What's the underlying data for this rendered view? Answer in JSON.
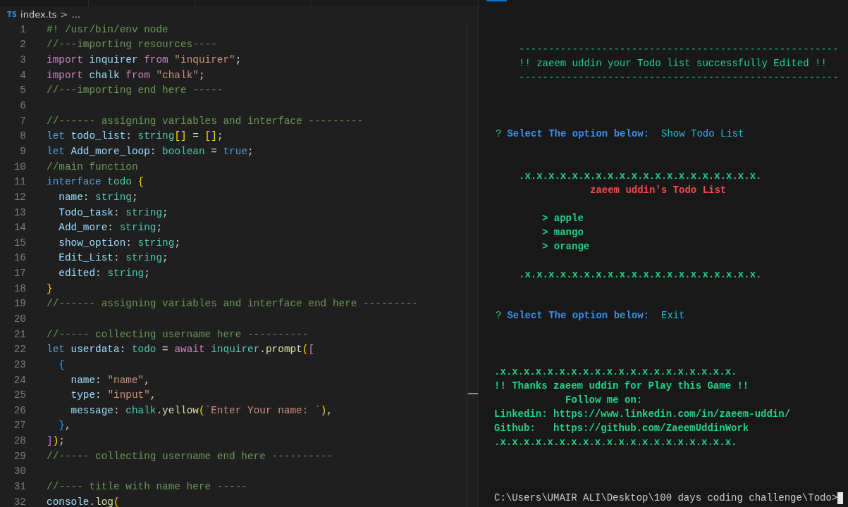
{
  "editor": {
    "breadcrumb": {
      "file_badge": "TS",
      "file": "index.ts",
      "separator": ">",
      "more": "..."
    },
    "lines": [
      {
        "number": "1",
        "tokens": [
          {
            "text": "#! /usr/bin/env node",
            "kind": "comment"
          }
        ]
      },
      {
        "number": "2",
        "tokens": [
          {
            "text": "//---importing resources----",
            "kind": "comment"
          }
        ]
      },
      {
        "number": "3",
        "tokens": [
          {
            "text": "import",
            "kind": "keyword"
          },
          {
            "text": " inquirer ",
            "kind": "variable"
          },
          {
            "text": "from",
            "kind": "keyword"
          },
          {
            "text": " \"inquirer\"",
            "kind": "string"
          },
          {
            "text": ";",
            "kind": "punct"
          }
        ]
      },
      {
        "number": "4",
        "tokens": [
          {
            "text": "import",
            "kind": "keyword"
          },
          {
            "text": " chalk ",
            "kind": "variable"
          },
          {
            "text": "from",
            "kind": "keyword"
          },
          {
            "text": " \"chalk\"",
            "kind": "string"
          },
          {
            "text": ";",
            "kind": "punct"
          }
        ]
      },
      {
        "number": "5",
        "tokens": [
          {
            "text": "//---importing end here -----",
            "kind": "comment"
          }
        ]
      },
      {
        "number": "6"
      },
      {
        "number": "7",
        "tokens": [
          {
            "text": "//------ assigning variables and interface ---------",
            "kind": "comment"
          }
        ]
      },
      {
        "number": "8",
        "tokens": [
          {
            "text": "let",
            "kind": "storage"
          },
          {
            "text": " todo_list",
            "kind": "variable"
          },
          {
            "text": ": ",
            "kind": "punct"
          },
          {
            "text": "string",
            "kind": "type"
          },
          {
            "text": "[]",
            "kind": "bracket1"
          },
          {
            "text": " = ",
            "kind": "punct"
          },
          {
            "text": "[]",
            "kind": "bracket1"
          },
          {
            "text": ";",
            "kind": "punct"
          }
        ]
      },
      {
        "number": "9",
        "tokens": [
          {
            "text": "let",
            "kind": "storage"
          },
          {
            "text": " Add_more_loop",
            "kind": "variable"
          },
          {
            "text": ": ",
            "kind": "punct"
          },
          {
            "text": "boolean",
            "kind": "type"
          },
          {
            "text": " = ",
            "kind": "punct"
          },
          {
            "text": "true",
            "kind": "storage"
          },
          {
            "text": ";",
            "kind": "punct"
          }
        ]
      },
      {
        "number": "10",
        "tokens": [
          {
            "text": "//main function",
            "kind": "comment"
          }
        ]
      },
      {
        "number": "11",
        "tokens": [
          {
            "text": "interface",
            "kind": "storage"
          },
          {
            "text": " todo ",
            "kind": "type"
          },
          {
            "text": "{",
            "kind": "bracket1"
          }
        ]
      },
      {
        "number": "12",
        "tokens": [
          {
            "text": "  name",
            "kind": "variable"
          },
          {
            "text": ": ",
            "kind": "punct"
          },
          {
            "text": "string",
            "kind": "type"
          },
          {
            "text": ";",
            "kind": "punct"
          }
        ]
      },
      {
        "number": "13",
        "tokens": [
          {
            "text": "  Todo_task",
            "kind": "variable"
          },
          {
            "text": ": ",
            "kind": "punct"
          },
          {
            "text": "string",
            "kind": "type"
          },
          {
            "text": ";",
            "kind": "punct"
          }
        ]
      },
      {
        "number": "14",
        "tokens": [
          {
            "text": "  Add_more",
            "kind": "variable"
          },
          {
            "text": ": ",
            "kind": "punct"
          },
          {
            "text": "string",
            "kind": "type"
          },
          {
            "text": ";",
            "kind": "punct"
          }
        ]
      },
      {
        "number": "15",
        "tokens": [
          {
            "text": "  show_option",
            "kind": "variable"
          },
          {
            "text": ": ",
            "kind": "punct"
          },
          {
            "text": "string",
            "kind": "type"
          },
          {
            "text": ";",
            "kind": "punct"
          }
        ]
      },
      {
        "number": "16",
        "tokens": [
          {
            "text": "  Edit_List",
            "kind": "variable"
          },
          {
            "text": ": ",
            "kind": "punct"
          },
          {
            "text": "string",
            "kind": "type"
          },
          {
            "text": ";",
            "kind": "punct"
          }
        ]
      },
      {
        "number": "17",
        "tokens": [
          {
            "text": "  edited",
            "kind": "variable"
          },
          {
            "text": ": ",
            "kind": "punct"
          },
          {
            "text": "string",
            "kind": "type"
          },
          {
            "text": ";",
            "kind": "punct"
          }
        ]
      },
      {
        "number": "18",
        "tokens": [
          {
            "text": "}",
            "kind": "bracket1"
          }
        ]
      },
      {
        "number": "19",
        "tokens": [
          {
            "text": "//------ assigning variables and interface end here ---------",
            "kind": "comment"
          }
        ]
      },
      {
        "number": "20"
      },
      {
        "number": "21",
        "tokens": [
          {
            "text": "//----- collecting username here ----------",
            "kind": "comment"
          }
        ]
      },
      {
        "number": "22",
        "tokens": [
          {
            "text": "let",
            "kind": "storage"
          },
          {
            "text": " userdata",
            "kind": "variable"
          },
          {
            "text": ": ",
            "kind": "punct"
          },
          {
            "text": "todo",
            "kind": "type"
          },
          {
            "text": " = ",
            "kind": "punct"
          },
          {
            "text": "await",
            "kind": "keyword"
          },
          {
            "text": " inquirer",
            "kind": "type"
          },
          {
            "text": ".",
            "kind": "punct"
          },
          {
            "text": "prompt",
            "kind": "function"
          },
          {
            "text": "(",
            "kind": "bracket1"
          },
          {
            "text": "[",
            "kind": "bracket2"
          }
        ]
      },
      {
        "number": "23",
        "tokens": [
          {
            "text": "  {",
            "kind": "bracket3"
          }
        ]
      },
      {
        "number": "24",
        "tokens": [
          {
            "text": "    name",
            "kind": "variable"
          },
          {
            "text": ": ",
            "kind": "punct"
          },
          {
            "text": "\"name\"",
            "kind": "string"
          },
          {
            "text": ",",
            "kind": "punct"
          }
        ]
      },
      {
        "number": "25",
        "tokens": [
          {
            "text": "    type",
            "kind": "variable"
          },
          {
            "text": ": ",
            "kind": "punct"
          },
          {
            "text": "\"input\"",
            "kind": "string"
          },
          {
            "text": ",",
            "kind": "punct"
          }
        ]
      },
      {
        "number": "26",
        "tokens": [
          {
            "text": "    message",
            "kind": "variable"
          },
          {
            "text": ": ",
            "kind": "punct"
          },
          {
            "text": "chalk",
            "kind": "type"
          },
          {
            "text": ".",
            "kind": "punct"
          },
          {
            "text": "yellow",
            "kind": "function"
          },
          {
            "text": "(",
            "kind": "bracket1"
          },
          {
            "text": "`Enter Your name: `",
            "kind": "string"
          },
          {
            "text": ")",
            "kind": "bracket1"
          },
          {
            "text": ",",
            "kind": "punct"
          }
        ]
      },
      {
        "number": "27",
        "tokens": [
          {
            "text": "  }",
            "kind": "bracket3"
          },
          {
            "text": ",",
            "kind": "punct"
          }
        ]
      },
      {
        "number": "28",
        "tokens": [
          {
            "text": "]",
            "kind": "bracket2"
          },
          {
            "text": ")",
            "kind": "bracket1"
          },
          {
            "text": ";",
            "kind": "punct"
          }
        ]
      },
      {
        "number": "29",
        "tokens": [
          {
            "text": "//----- collecting username end here ----------",
            "kind": "comment"
          }
        ]
      },
      {
        "number": "30"
      },
      {
        "number": "31",
        "tokens": [
          {
            "text": "//---- title with name here -----",
            "kind": "comment"
          }
        ]
      },
      {
        "number": "32",
        "tokens": [
          {
            "text": "console",
            "kind": "variable"
          },
          {
            "text": ".",
            "kind": "punct"
          },
          {
            "text": "log",
            "kind": "function"
          },
          {
            "text": "(",
            "kind": "bracket1"
          }
        ]
      }
    ]
  },
  "terminal": {
    "blocks": [
      {
        "kind": "banner",
        "rule_top": "------------------------------------------------------",
        "message": "!! zaeem uddin your Todo list successfully Edited !!",
        "rule_bottom": "------------------------------------------------------"
      },
      {
        "kind": "question",
        "mark": "?",
        "label": "Select The option below:",
        "answer": "Show Todo List"
      },
      {
        "kind": "todo_list",
        "border_top": ".x.x.x.x.x.x.x.x.x.x.x.x.x.x.x.x.x.x.x.x.",
        "heading": "zaeem uddin's Todo List",
        "marker": ">",
        "items": [
          "apple",
          "mango",
          "orange"
        ],
        "border_bottom": ".x.x.x.x.x.x.x.x.x.x.x.x.x.x.x.x.x.x.x.x."
      },
      {
        "kind": "question",
        "mark": "?",
        "label": "Select The option below:",
        "answer": "Exit"
      },
      {
        "kind": "farewell",
        "border_top": ".x.x.x.x.x.x.x.x.x.x.x.x.x.x.x.x.x.x.x.x.",
        "thanks": "!! Thanks zaeem uddin for Play this Game !!",
        "follow": "Follow me on:",
        "links": [
          "Linkedin: https://www.linkedin.com/in/zaeem-uddin/",
          "Github:   https://github.com/ZaeemUddinWork"
        ],
        "border_bottom": ".x.x.x.x.x.x.x.x.x.x.x.x.x.x.x.x.x.x.x.x."
      }
    ],
    "prompt": "C:\\Users\\UMAIR ALI\\Desktop\\100 days coding challenge\\Todo>"
  }
}
